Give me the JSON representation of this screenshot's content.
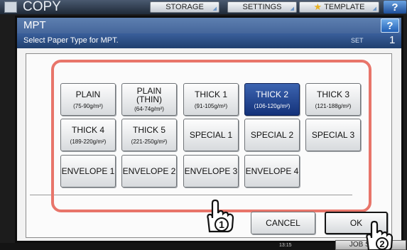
{
  "app": {
    "title": "COPY",
    "tabs": [
      {
        "label": "STORAGE"
      },
      {
        "label": "SETTINGS"
      },
      {
        "label": "TEMPLATE"
      }
    ],
    "help": "?"
  },
  "dialog": {
    "title": "MPT",
    "help": "?",
    "instruction": "Select Paper Type for MPT.",
    "set_label": "SET",
    "set_value": "1"
  },
  "paper_types": [
    {
      "name": "PLAIN",
      "range": "(75-90g/m²)",
      "selected": false
    },
    {
      "name": "PLAIN\n(THIN)",
      "range": "(64-74g/m²)",
      "selected": false
    },
    {
      "name": "THICK 1",
      "range": "(91-105g/m²)",
      "selected": false
    },
    {
      "name": "THICK 2",
      "range": "(106-120g/m²)",
      "selected": true
    },
    {
      "name": "THICK 3",
      "range": "(121-188g/m²)",
      "selected": false
    },
    {
      "name": "THICK 4",
      "range": "(189-220g/m²)",
      "selected": false
    },
    {
      "name": "THICK 5",
      "range": "(221-250g/m²)",
      "selected": false
    },
    {
      "name": "SPECIAL 1",
      "range": "",
      "selected": false
    },
    {
      "name": "SPECIAL 2",
      "range": "",
      "selected": false
    },
    {
      "name": "SPECIAL 3",
      "range": "",
      "selected": false
    },
    {
      "name": "ENVELOPE 1",
      "range": "",
      "selected": false
    },
    {
      "name": "ENVELOPE 2",
      "range": "",
      "selected": false
    },
    {
      "name": "ENVELOPE 3",
      "range": "",
      "selected": false
    },
    {
      "name": "ENVELOPE 4",
      "range": "",
      "selected": false
    }
  ],
  "actions": {
    "cancel": "CANCEL",
    "ok": "OK"
  },
  "callouts": {
    "step1": "1",
    "step2": "2"
  },
  "status": {
    "time": "13:15",
    "job": "JOB STATUS"
  },
  "colors": {
    "highlight": "#e8756a",
    "selected": "#1e3f8c",
    "header": "#3a5f9b"
  }
}
